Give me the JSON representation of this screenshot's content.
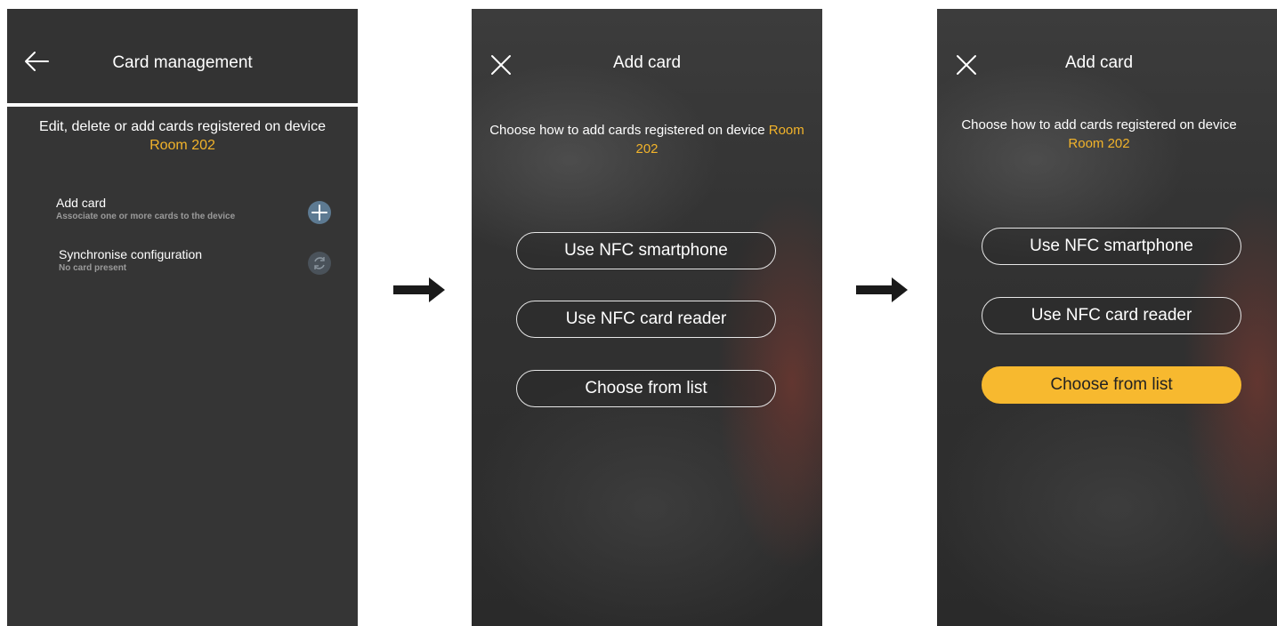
{
  "screen1": {
    "title": "Card management",
    "description_prefix": "Edit, delete or add cards registered on device",
    "device_name": "Room 202",
    "items": [
      {
        "label": "Add card",
        "subtitle": "Associate one or more cards to the device",
        "icon": "plus-icon"
      },
      {
        "label": "Synchronise configuration",
        "subtitle": "No card present",
        "icon": "sync-icon"
      }
    ]
  },
  "screen2": {
    "title": "Add card",
    "description_prefix": "Choose how to add cards registered on device",
    "device_name": "Room 202",
    "options": [
      "Use NFC smartphone",
      "Use NFC card reader",
      "Choose from list"
    ]
  },
  "screen3": {
    "title": "Add card",
    "description_prefix": "Choose how to add cards registered on device",
    "device_name": "Room 202",
    "options": [
      "Use NFC smartphone",
      "Use NFC card reader",
      "Choose from list"
    ],
    "selected_option": "Choose from list"
  },
  "colors": {
    "accent": "#f2b32a",
    "selected_button": "#f7b92f",
    "screen_background": "#353535"
  },
  "icons": [
    "back-arrow-icon",
    "plus-icon",
    "sync-icon",
    "close-icon",
    "right-arrow-icon"
  ]
}
